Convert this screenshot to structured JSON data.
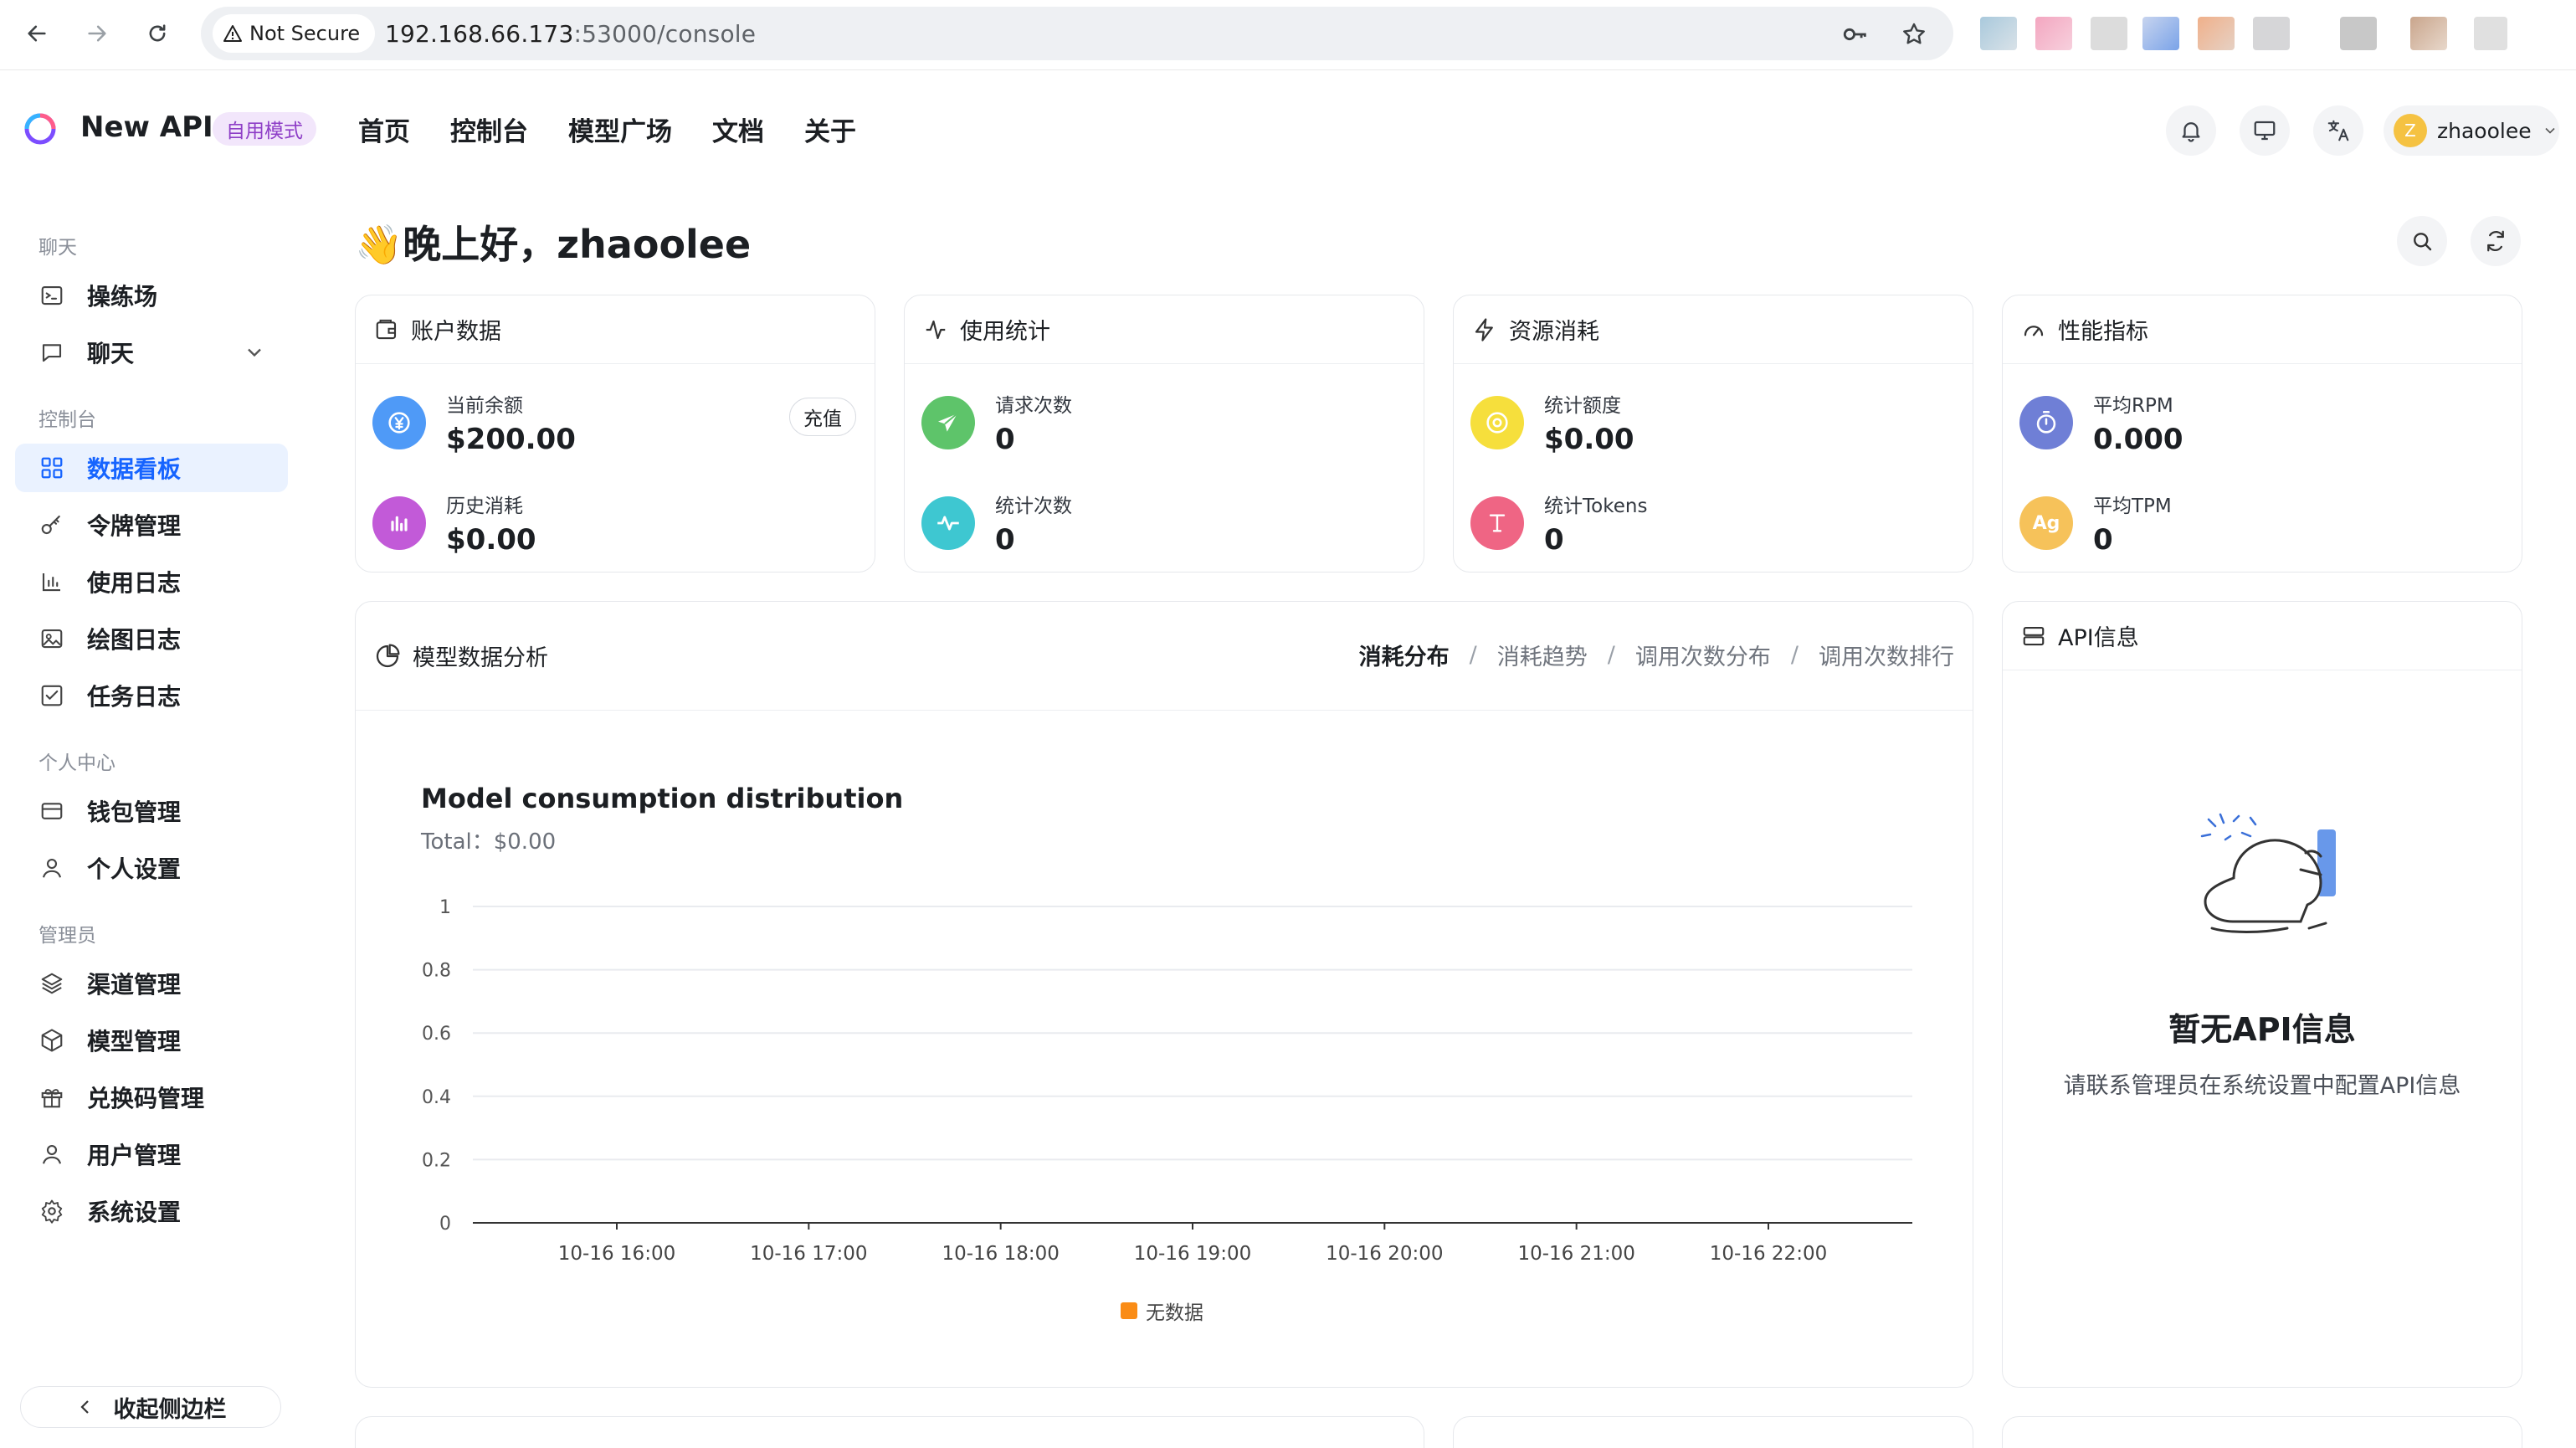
{
  "browser": {
    "not_secure": "Not Secure",
    "url_host": "192.168.66.173",
    "url_rest": ":53000/console"
  },
  "header": {
    "app_name": "New API",
    "mode_badge": "自用模式",
    "nav": [
      "首页",
      "控制台",
      "模型广场",
      "文档",
      "关于"
    ],
    "username": "zhaoolee",
    "avatar_letter": "Z"
  },
  "sidebar": {
    "groups": {
      "chat": "聊天",
      "console": "控制台",
      "personal": "个人中心",
      "admin": "管理员"
    },
    "items": {
      "playground": "操练场",
      "chat": "聊天",
      "dashboard": "数据看板",
      "tokens": "令牌管理",
      "usage_log": "使用日志",
      "drawing_log": "绘图日志",
      "task_log": "任务日志",
      "wallet": "钱包管理",
      "personal_settings": "个人设置",
      "channels": "渠道管理",
      "models": "模型管理",
      "redemption": "兑换码管理",
      "users": "用户管理",
      "system_settings": "系统设置"
    },
    "collapse": "收起侧边栏"
  },
  "main": {
    "greeting": "👋晚上好，zhaoolee",
    "cards": {
      "account": {
        "title": "账户数据",
        "balance_label": "当前余额",
        "balance_value": "$200.00",
        "recharge": "充值",
        "history_label": "历史消耗",
        "history_value": "$0.00"
      },
      "usage": {
        "title": "使用统计",
        "requests_label": "请求次数",
        "requests_value": "0",
        "count_label": "统计次数",
        "count_value": "0"
      },
      "resource": {
        "title": "资源消耗",
        "quota_label": "统计额度",
        "quota_value": "$0.00",
        "tokens_label": "统计Tokens",
        "tokens_value": "0"
      },
      "performance": {
        "title": "性能指标",
        "rpm_label": "平均RPM",
        "rpm_value": "0.000",
        "tpm_label": "平均TPM",
        "tpm_value": "0",
        "tpm_badge": "Ag"
      }
    },
    "analysis": {
      "title": "模型数据分析",
      "tabs": [
        "消耗分布",
        "消耗趋势",
        "调用次数分布",
        "调用次数排行"
      ],
      "active_tab": 0,
      "chart_title": "Model consumption distribution",
      "chart_total": "Total：$0.00",
      "legend": "无数据"
    },
    "api_info": {
      "title": "API信息",
      "empty_title": "暂无API信息",
      "empty_desc": "请联系管理员在系统设置中配置API信息"
    }
  },
  "colors": {
    "accent": "#1664ff",
    "legend_no_data": "#fa8c16"
  },
  "chart_data": {
    "type": "bar",
    "title": "Model consumption distribution",
    "subtitle": "Total：$0.00",
    "categories": [
      "10-16 16:00",
      "10-16 17:00",
      "10-16 18:00",
      "10-16 19:00",
      "10-16 20:00",
      "10-16 21:00",
      "10-16 22:00"
    ],
    "y_ticks": [
      "0",
      "0.2",
      "0.4",
      "0.6",
      "0.8",
      "1"
    ],
    "ylim": [
      0,
      1
    ],
    "series": [
      {
        "name": "无数据",
        "values": [
          0,
          0,
          0,
          0,
          0,
          0,
          0
        ]
      }
    ],
    "grid": true,
    "legend_position": "bottom"
  }
}
